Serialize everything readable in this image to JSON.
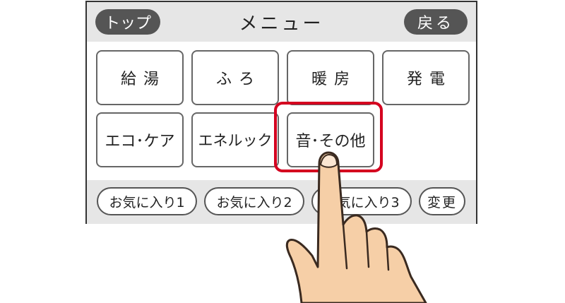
{
  "header": {
    "title": "メニュー",
    "top_button": "トップ",
    "back_button": "戻る"
  },
  "menu": {
    "row1": [
      "給湯",
      "ふろ",
      "暖房",
      "発電"
    ],
    "row2": [
      "エコ･ケア",
      "エネルック",
      "音･その他"
    ],
    "selected": "音･その他"
  },
  "favorites": {
    "items": [
      "お気に入り1",
      "お気に入り2",
      "お気に入り3"
    ],
    "change_button": "変更"
  },
  "colors": {
    "highlight": "#d4001f",
    "pill_button": "#555555",
    "hand_skin": "#f6cfa7"
  },
  "icons": [
    "pointing-finger-icon"
  ]
}
